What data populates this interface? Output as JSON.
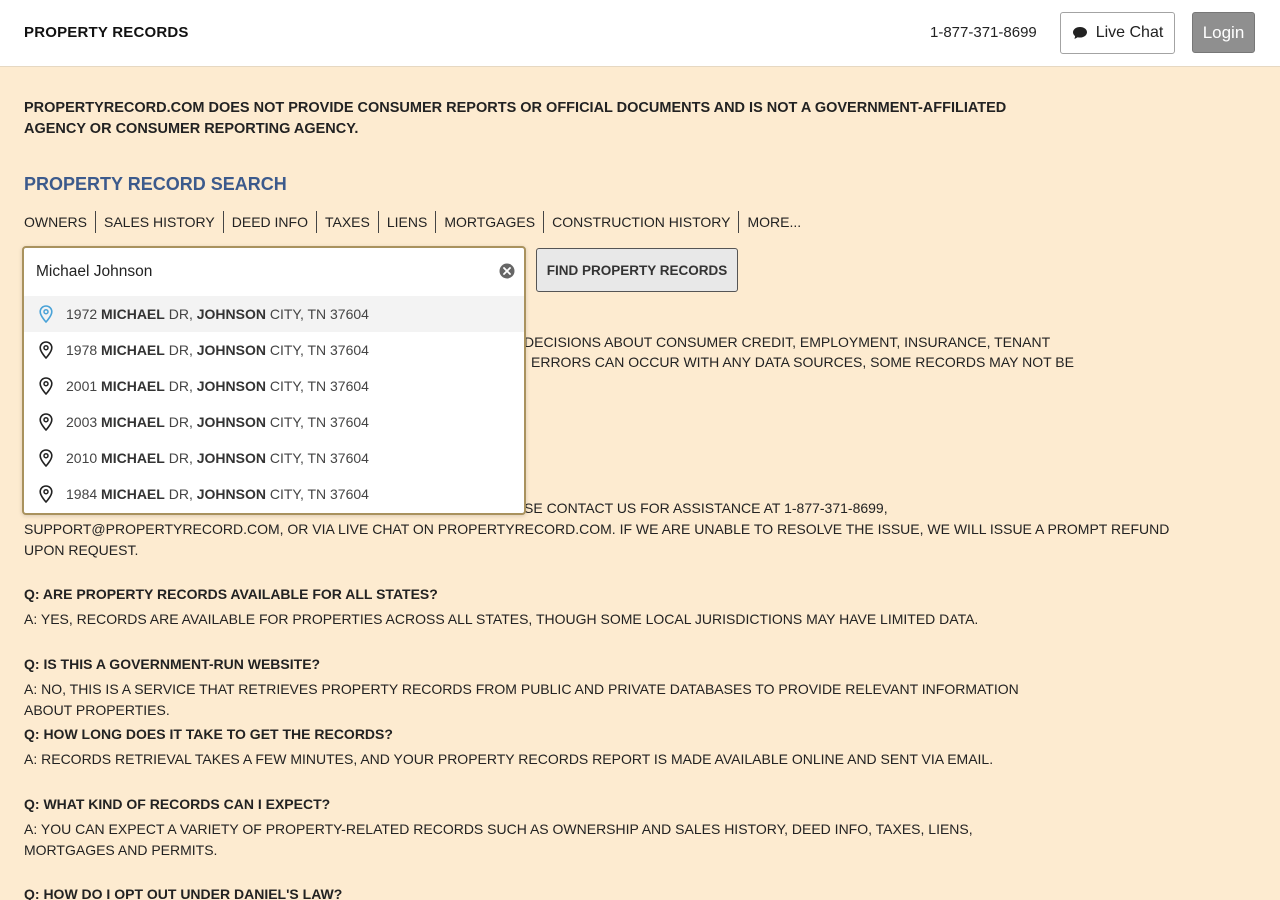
{
  "header": {
    "brand": "PROPERTY RECORDS",
    "phone": "1-877-371-8699",
    "chat_label": "Live Chat",
    "login_label": "Login"
  },
  "disclaimer": "PROPERTYRECORD.COM DOES NOT PROVIDE CONSUMER REPORTS OR OFFICIAL DOCUMENTS AND IS NOT A GOVERNMENT-AFFILIATED AGENCY OR CONSUMER REPORTING AGENCY.",
  "search": {
    "title": "PROPERTY RECORD SEARCH",
    "tabs": [
      "OWNERS",
      "SALES HISTORY",
      "DEED INFO",
      "TAXES",
      "LIENS",
      "MORTGAGES",
      "CONSTRUCTION HISTORY",
      "MORE..."
    ],
    "value": "Michael Johnson",
    "button_label": "FIND PROPERTY RECORDS",
    "suggestions": [
      {
        "num": "1972",
        "street": "MICHAEL",
        "suffix": "DR,",
        "city_bold": "JOHNSON",
        "rest": "CITY, TN 37604"
      },
      {
        "num": "1978",
        "street": "MICHAEL",
        "suffix": "DR,",
        "city_bold": "JOHNSON",
        "rest": "CITY, TN 37604"
      },
      {
        "num": "2001",
        "street": "MICHAEL",
        "suffix": "DR,",
        "city_bold": "JOHNSON",
        "rest": "CITY, TN 37604"
      },
      {
        "num": "2003",
        "street": "MICHAEL",
        "suffix": "DR,",
        "city_bold": "JOHNSON",
        "rest": "CITY, TN 37604"
      },
      {
        "num": "2010",
        "street": "MICHAEL",
        "suffix": "DR,",
        "city_bold": "JOHNSON",
        "rest": "CITY, TN 37604"
      },
      {
        "num": "1984",
        "street": "MICHAEL",
        "suffix": "DR,",
        "city_bold": "JOHNSON",
        "rest": "CITY, TN 37604"
      }
    ]
  },
  "partial_text": {
    "line1": "DECISIONS ABOUT CONSUMER CREDIT, EMPLOYMENT, INSURANCE, TENANT",
    "line2": "ERRORS CAN OCCUR WITH ANY DATA SOURCES, SOME RECORDS MAY NOT BE",
    "line3": "SE CONTACT US FOR ASSISTANCE AT 1-877-371-8699,",
    "line4": "SUPPORT@PROPERTYRECORD.COM, OR VIA LIVE CHAT ON PROPERTYRECORD.COM. IF WE ARE UNABLE TO RESOLVE THE ISSUE, WE WILL ISSUE A PROMPT REFUND",
    "line5": "UPON REQUEST."
  },
  "faq": [
    {
      "q": "Q: ARE PROPERTY RECORDS AVAILABLE FOR ALL STATES?",
      "a": "A: YES, RECORDS ARE AVAILABLE FOR PROPERTIES ACROSS ALL STATES, THOUGH SOME LOCAL JURISDICTIONS MAY HAVE LIMITED DATA."
    },
    {
      "q": "Q: IS THIS A GOVERNMENT-RUN WEBSITE?",
      "a": "A: NO, THIS IS A SERVICE THAT RETRIEVES PROPERTY RECORDS FROM PUBLIC AND PRIVATE DATABASES TO PROVIDE RELEVANT INFORMATION ABOUT PROPERTIES."
    },
    {
      "q": "Q: HOW LONG DOES IT TAKE TO GET THE RECORDS?",
      "a": "A: RECORDS RETRIEVAL TAKES A FEW MINUTES, AND YOUR PROPERTY RECORDS REPORT IS MADE AVAILABLE ONLINE AND SENT VIA EMAIL."
    },
    {
      "q": "Q: WHAT KIND OF RECORDS CAN I EXPECT?",
      "a": "A: YOU CAN EXPECT A VARIETY OF PROPERTY-RELATED RECORDS SUCH AS OWNERSHIP AND SALES HISTORY, DEED INFO, TAXES, LIENS, MORTGAGES AND PERMITS."
    },
    {
      "q": "Q: HOW DO I OPT OUT UNDER DANIEL'S LAW?",
      "a": ""
    }
  ],
  "colors": {
    "background": "#fdebd0",
    "title": "#3c5a8c",
    "active_pin": "#4aa3d8"
  },
  "icons": {
    "chat": "chat-bubble-icon",
    "clear": "clear-circle-icon",
    "pin": "map-pin-icon"
  }
}
